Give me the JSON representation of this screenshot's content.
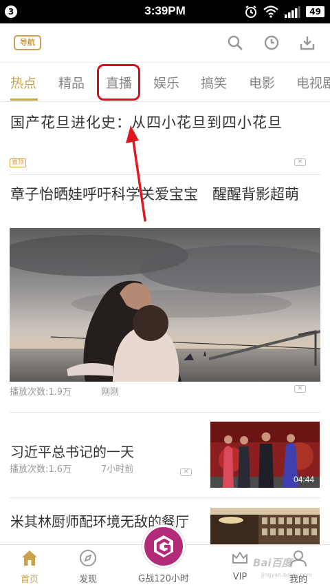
{
  "status_bar": {
    "notification_count": "3",
    "time": "3:39PM",
    "battery": "49",
    "icons": [
      "alarm-icon",
      "wifi-icon",
      "signal-icon",
      "battery-icon"
    ]
  },
  "header": {
    "nav_button": "导航",
    "icons": [
      "search-icon",
      "history-icon",
      "download-icon"
    ]
  },
  "tabs": [
    {
      "label": "热点",
      "active": true
    },
    {
      "label": "精品"
    },
    {
      "label": "直播",
      "highlighted": true
    },
    {
      "label": "娱乐"
    },
    {
      "label": "搞笑"
    },
    {
      "label": "电影"
    },
    {
      "label": "电视剧"
    }
  ],
  "feed": {
    "headline": "国产花旦进化史：从四小花旦到四小花旦",
    "pin_badge": "置顶",
    "close_symbol": "✕",
    "item1": {
      "title": "章子怡晒娃呼吁科学关爱宝宝　醒醒背影超萌",
      "plays": "播放次数:1.9万",
      "time": "刚刚"
    },
    "item2": {
      "title": "习近平总书记的一天",
      "plays": "播放次数:1.6万",
      "time": "7小时前",
      "duration": "04:44"
    },
    "item3": {
      "title": "米其林厨师配环境无敌的餐厅"
    }
  },
  "bottom_nav": [
    {
      "label": "首页",
      "icon": "home-icon",
      "active": true
    },
    {
      "label": "发现",
      "icon": "compass-icon"
    },
    {
      "label": "G战120小时",
      "icon": "g-logo-icon"
    },
    {
      "label": "VIP",
      "icon": "crown-icon"
    },
    {
      "label": "我的",
      "icon": "user-icon"
    }
  ],
  "watermark": {
    "text": "Bai百度",
    "sub": "jingyan.baidu.com"
  },
  "colors": {
    "accent": "#c9a24b",
    "highlight_red": "#d3101b",
    "center_button": "#b22a78"
  }
}
